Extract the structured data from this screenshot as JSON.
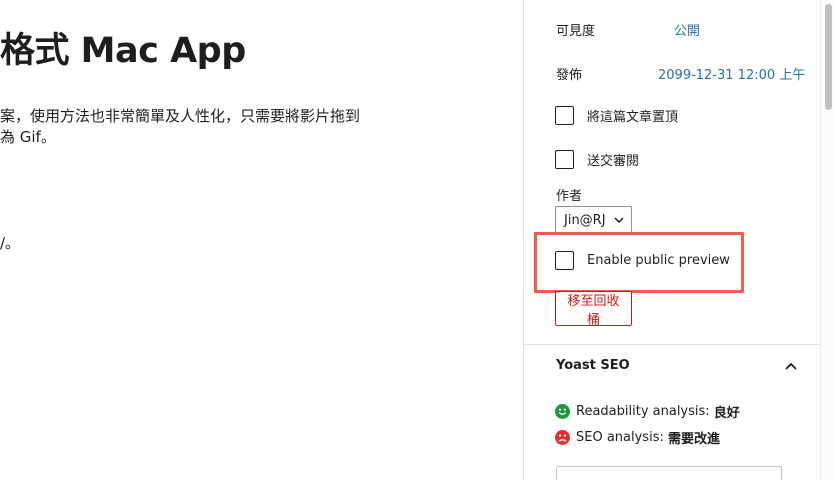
{
  "editor": {
    "title": "格式 Mac App",
    "paragraph1_line1": "案，使用方法也非常簡單及人性化，只需要將影片拖到",
    "paragraph1_line2": "為 Gif。",
    "paragraph2": "/。"
  },
  "sidebar": {
    "visibility": {
      "label": "可見度",
      "value": "公開"
    },
    "publish": {
      "label": "發佈",
      "value": "2099-12-31 12:00 上午"
    },
    "sticky_checkbox": {
      "label": "將這篇文章置頂",
      "checked": false
    },
    "review_checkbox": {
      "label": "送交審閱",
      "checked": false
    },
    "author": {
      "label": "作者",
      "selected": "Jin@RJ"
    },
    "public_preview_checkbox": {
      "label": "Enable public preview",
      "checked": false
    },
    "highlight_color": "#f25b4e",
    "trash_button": "移至回收桶"
  },
  "yoast": {
    "title": "Yoast SEO",
    "readability": {
      "label": "Readability analysis:",
      "status": "良好",
      "color": "#1a9a3b"
    },
    "seo": {
      "label": "SEO analysis:",
      "status": "需要改進",
      "color": "#dc3232"
    }
  },
  "icons": {
    "author_dropdown": "chevron-down-icon",
    "yoast_toggle": "chevron-up-icon",
    "readability": "smiley-good-icon",
    "seo": "smiley-bad-icon"
  }
}
